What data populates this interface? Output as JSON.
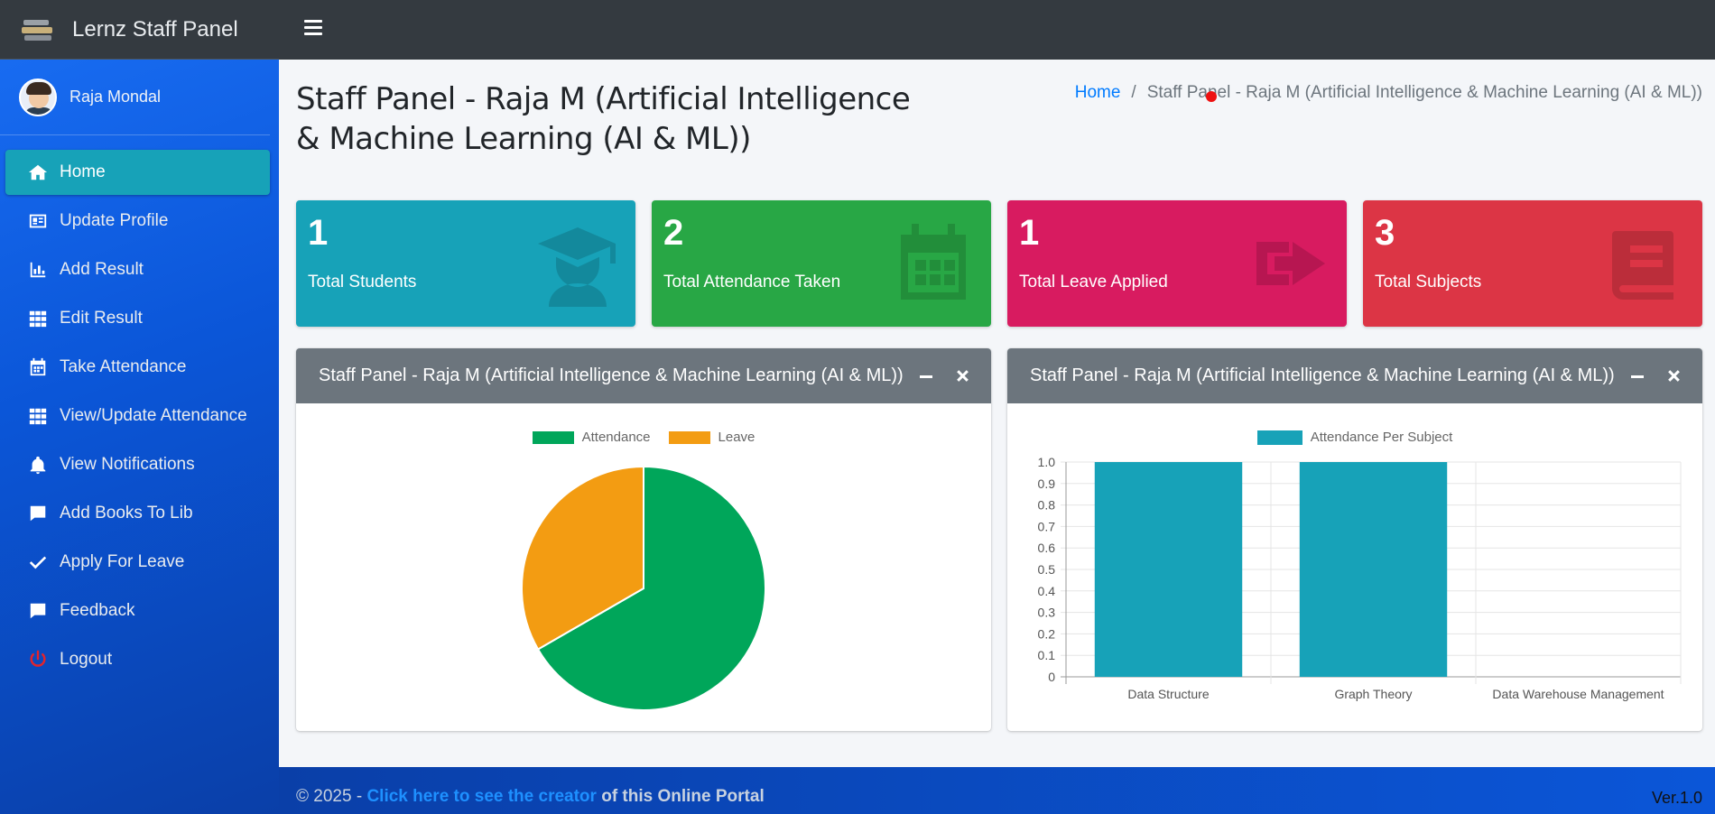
{
  "brand": {
    "title": "Lernz Staff Panel"
  },
  "user": {
    "name": "Raja Mondal"
  },
  "sidebar": {
    "items": [
      {
        "label": "Home",
        "icon": "home-icon",
        "active": true
      },
      {
        "label": "Update Profile",
        "icon": "id-card-icon"
      },
      {
        "label": "Add Result",
        "icon": "bar-chart-icon"
      },
      {
        "label": "Edit Result",
        "icon": "grid-icon"
      },
      {
        "label": "Take Attendance",
        "icon": "calendar-icon"
      },
      {
        "label": "View/Update Attendance",
        "icon": "grid-icon"
      },
      {
        "label": "View Notifications",
        "icon": "bell-icon"
      },
      {
        "label": "Add Books To Lib",
        "icon": "comment-icon"
      },
      {
        "label": "Apply For Leave",
        "icon": "check-icon"
      },
      {
        "label": "Feedback",
        "icon": "comment-icon"
      },
      {
        "label": "Logout",
        "icon": "power-icon"
      }
    ]
  },
  "page": {
    "title": "Staff Panel - Raja M (Artificial Intelligence & Machine Learning (AI & ML))",
    "breadcrumb_home": "Home",
    "breadcrumb_current": "Staff Panel - Raja M (Artificial Intelligence & Machine Learning (AI & ML))"
  },
  "stats": [
    {
      "value": "1",
      "label": "Total Students",
      "color": "#17a2b8",
      "icon": "graduate-icon"
    },
    {
      "value": "2",
      "label": "Total Attendance Taken",
      "color": "#28a745",
      "icon": "calendar-icon"
    },
    {
      "value": "1",
      "label": "Total Leave Applied",
      "color": "#d81b60",
      "icon": "share-icon"
    },
    {
      "value": "3",
      "label": "Total Subjects",
      "color": "#dc3545",
      "icon": "book-icon"
    }
  ],
  "cards": {
    "pie_title": "Staff Panel - Raja M (Artificial Intelligence & Machine Learning (AI & ML))",
    "bar_title": "Staff Panel - Raja M (Artificial Intelligence & Machine Learning (AI & ML))"
  },
  "chart_data": [
    {
      "type": "pie",
      "categories": [
        "Attendance",
        "Leave"
      ],
      "values": [
        2,
        1
      ],
      "colors": [
        "#00a65a",
        "#f39c12"
      ],
      "legend": "top"
    },
    {
      "type": "bar",
      "categories": [
        "Data Structure",
        "Graph Theory",
        "Data Warehouse Management"
      ],
      "series": [
        {
          "name": "Attendance Per Subject",
          "values": [
            1,
            1,
            0
          ],
          "color": "#17a2b8"
        }
      ],
      "ylim": [
        0,
        1
      ],
      "yticks": [
        "0",
        "0.1",
        "0.2",
        "0.3",
        "0.4",
        "0.5",
        "0.6",
        "0.7",
        "0.8",
        "0.9",
        "1.0"
      ],
      "grid": true,
      "legend": "top"
    }
  ],
  "footer": {
    "prefix": "© 2025 - ",
    "link": "Click here to see the creator",
    "suffix": " of this Online Portal",
    "version": "Ver.1.0"
  }
}
